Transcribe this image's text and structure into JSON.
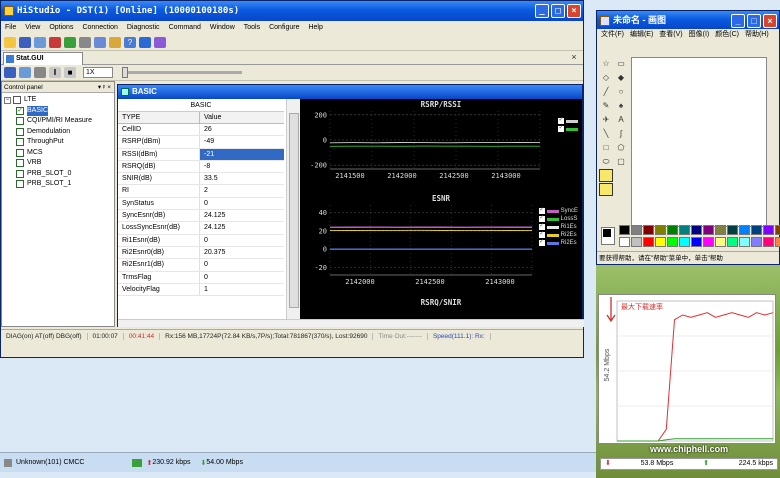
{
  "main_window": {
    "title": "HiStudio - DST(1) [Online] (10000100180s)",
    "menu": [
      "File",
      "View",
      "Options",
      "Connection",
      "Diagnostic",
      "Command",
      "Window",
      "Tools",
      "Configure",
      "Help"
    ],
    "zoom_value": "1X",
    "tab_label": "Stat.GUI",
    "control_panel_title": "Control panel"
  },
  "tree": {
    "root": "LTE",
    "items": [
      "BASIC",
      "CQI/PMI/RI Measure",
      "Demodulation",
      "ThroughPut",
      "MCS",
      "VRB",
      "PRB_SLOT_0",
      "PRB_SLOT_1"
    ]
  },
  "basic": {
    "window_title": "BASIC",
    "caption": "BASIC",
    "col_type": "TYPE",
    "col_value": "Value",
    "rows": [
      {
        "type": "CellID",
        "value": "26"
      },
      {
        "type": "RSRP(dBm)",
        "value": "-49"
      },
      {
        "type": "RSSI(dBm)",
        "value": "-21"
      },
      {
        "type": "RSRQ(dB)",
        "value": "-8"
      },
      {
        "type": "SNIR(dB)",
        "value": "33.5"
      },
      {
        "type": "RI",
        "value": "2"
      },
      {
        "type": "SynStatus",
        "value": "0"
      },
      {
        "type": "SyncEsnr(dB)",
        "value": "24.125"
      },
      {
        "type": "LossSyncEsnr(dB)",
        "value": "24.125"
      },
      {
        "type": "Ri1Esnr(dB)",
        "value": "0"
      },
      {
        "type": "Ri2Esnr0(dB)",
        "value": "20.375"
      },
      {
        "type": "Ri2Esnr1(dB)",
        "value": "0"
      },
      {
        "type": "TrmsFlag",
        "value": "0"
      },
      {
        "type": "VelocityFlag",
        "value": "1"
      }
    ]
  },
  "chart_data": [
    {
      "type": "line",
      "title": "RSRP/RSSI",
      "x_ticks": [
        "2141500",
        "2142000",
        "2142500",
        "2143000"
      ],
      "y_ticks": [
        "200",
        "0",
        "-200"
      ],
      "ylim": [
        -230,
        230
      ],
      "series": [
        {
          "values": [
            -22,
            -21,
            -22,
            -20,
            -21,
            -22,
            -21,
            -21,
            -20,
            -21
          ],
          "color": "#d0d0d0"
        },
        {
          "values": [
            -50,
            -49,
            -49,
            -50,
            -48,
            -49,
            -49,
            -50,
            -49,
            -49
          ],
          "color": "#34c034"
        }
      ]
    },
    {
      "type": "line",
      "title": "ESNR",
      "x_ticks": [
        "2142000",
        "2142500",
        "2143000"
      ],
      "y_ticks": [
        "40",
        "20",
        "0",
        "-20"
      ],
      "ylim": [
        -28,
        48
      ],
      "legend": [
        "SyncE",
        "LossS",
        "Ri1Es",
        "Ri2Es",
        "Ri2Es"
      ],
      "series": [
        {
          "name": "SyncE",
          "values": [
            24,
            24.1,
            24.2,
            24,
            24.1,
            24.1,
            24,
            24.2,
            24.1,
            24.1
          ],
          "color": "#c060c0"
        },
        {
          "name": "LossS",
          "values": [
            23.5,
            23.6,
            23.7,
            23.5,
            23.6,
            23.5,
            23.6,
            23.7,
            23.6,
            23.6
          ],
          "color": "#34c034"
        },
        {
          "name": "Ri1Es",
          "values": [
            0,
            0,
            0,
            0,
            0,
            0,
            0,
            0,
            0,
            0
          ],
          "color": "#e8e8e8"
        },
        {
          "name": "Ri2Es",
          "values": [
            20.4,
            20.3,
            20.4,
            20.4,
            20.5,
            20.3,
            20.4,
            20.4,
            20.3,
            20.4
          ],
          "color": "#e8d020"
        },
        {
          "name": "Ri2Es",
          "values": [
            0.3,
            0.3,
            0.3,
            0.3,
            0.3,
            0.3,
            0.3,
            0.3,
            0.3,
            0.3
          ],
          "color": "#5a78e0"
        }
      ]
    },
    {
      "type": "line",
      "title": "RSRQ/SNIR"
    },
    {
      "type": "line",
      "title": "",
      "ylabel": "54.2 Mbps",
      "annotation": "最大下载速率",
      "series": [
        {
          "name": "53.8 Mbps",
          "values": [
            0,
            0,
            0,
            0,
            0,
            0,
            5,
            52,
            54,
            53,
            54,
            55,
            53,
            54,
            55,
            54,
            53,
            55,
            54,
            55
          ],
          "color": "#e03030"
        },
        {
          "name": "224.5 kbps",
          "values": [
            0,
            0,
            0,
            0,
            0,
            0,
            0.5,
            1,
            1,
            1,
            1,
            1,
            1,
            1,
            1,
            1,
            1,
            1,
            1,
            1
          ],
          "color": "#30a030"
        }
      ],
      "ylim": [
        0,
        60
      ]
    }
  ],
  "status_bar": {
    "diag": "DIAG(on) AT(off) DBG(off)",
    "time": "01:00:07",
    "elapsed": "00:41:44",
    "rx": "Rx:156 MB,17724P(72.84 KB/s,7P/s);Total:781867(370/s), Lost:92690",
    "timeout": "Time Out:-------",
    "speed": "Speed(111.1): Rx:"
  },
  "taskbar": {
    "network": "Unknown(101) CMCC",
    "upload": "230.92 kbps",
    "download": "54.00 Mbps"
  },
  "paint": {
    "title": "未命名 - 画图",
    "menu": [
      "文件(F)",
      "编辑(E)",
      "查看(V)",
      "图像(I)",
      "颜色(C)",
      "帮助(H)"
    ],
    "status": "要获得帮助，请在\"帮助\"菜单中，单击\"帮助"
  },
  "speed": {
    "down_label": "53.8 Mbps",
    "up_label": "224.5 kbps"
  },
  "watermark": "www.chiphell.com",
  "colors": {
    "accent": "#0a5ae0",
    "selection": "#316ac5",
    "chart_bg": "#000000"
  }
}
